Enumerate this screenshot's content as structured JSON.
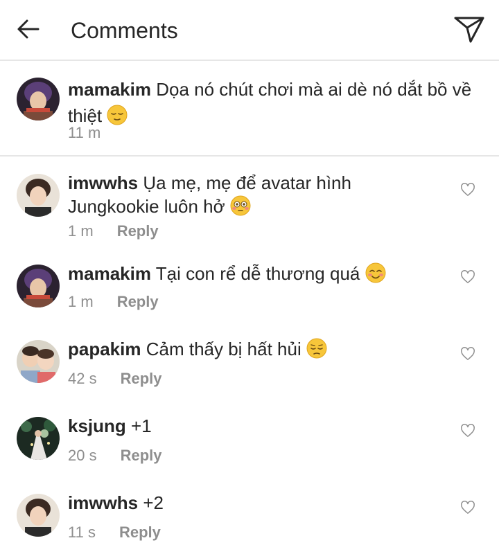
{
  "header": {
    "title": "Comments",
    "back_icon": "arrow-left-icon",
    "send_icon": "paper-plane-icon"
  },
  "caption": {
    "username": "mamakim",
    "text": "Dọa nó chút chơi mà ai dè nó dắt bồ về thiệt",
    "emoji": "relieved-face-emoji",
    "time": "11 m"
  },
  "comments": [
    {
      "username": "imwwhs",
      "text": "Ụa mẹ, mẹ để avatar hình Jungkookie luôn hở",
      "emoji": "flushed-face-emoji",
      "time": "1 m",
      "reply_label": "Reply"
    },
    {
      "username": "mamakim",
      "text": "Tại con rể dễ thương quá",
      "emoji": "smiling-blush-face-emoji",
      "time": "1 m",
      "reply_label": "Reply"
    },
    {
      "username": "papakim",
      "text": "Cảm thấy bị hất hủi",
      "emoji": "pensive-face-emoji",
      "time": "42 s",
      "reply_label": "Reply"
    },
    {
      "username": "ksjung",
      "text": "+1",
      "emoji": "",
      "time": "20 s",
      "reply_label": "Reply"
    },
    {
      "username": "imwwhs",
      "text": "+2",
      "emoji": "",
      "time": "11 s",
      "reply_label": "Reply"
    }
  ],
  "colors": {
    "text": "#262626",
    "secondary": "#8e8e8e",
    "divider": "#e6e6e6",
    "emoji_yellow": "#f7c63a"
  }
}
